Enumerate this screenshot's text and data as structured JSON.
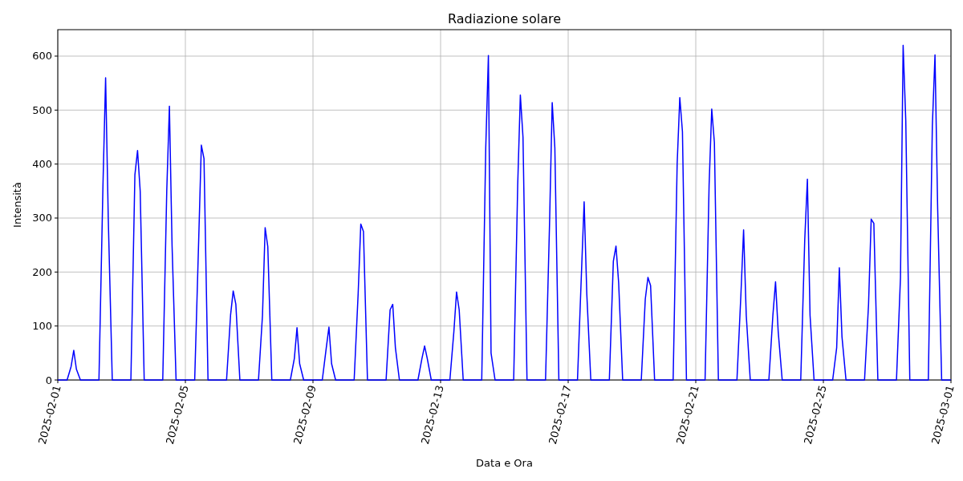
{
  "chart_data": {
    "type": "line",
    "title": "Radiazione solare",
    "xlabel": "Data e Ora",
    "ylabel": "Intensità",
    "x": [
      "2025-02-01T00:00",
      "2025-02-01T07:00",
      "2025-02-01T10:00",
      "2025-02-01T12:00",
      "2025-02-01T14:00",
      "2025-02-01T17:00",
      "2025-02-02T07:00",
      "2025-02-02T10:00",
      "2025-02-02T12:00",
      "2025-02-02T14:00",
      "2025-02-02T17:00",
      "2025-02-03T07:00",
      "2025-02-03T10:00",
      "2025-02-03T12:00",
      "2025-02-03T14:00",
      "2025-02-03T17:00",
      "2025-02-04T07:00",
      "2025-02-04T10:00",
      "2025-02-04T12:00",
      "2025-02-04T14:00",
      "2025-02-04T17:00",
      "2025-02-05T07:00",
      "2025-02-05T10:00",
      "2025-02-05T12:00",
      "2025-02-05T14:00",
      "2025-02-05T17:00",
      "2025-02-06T07:00",
      "2025-02-06T10:00",
      "2025-02-06T12:00",
      "2025-02-06T14:00",
      "2025-02-06T17:00",
      "2025-02-07T07:00",
      "2025-02-07T10:00",
      "2025-02-07T12:00",
      "2025-02-07T14:00",
      "2025-02-07T17:00",
      "2025-02-08T07:00",
      "2025-02-08T10:00",
      "2025-02-08T12:00",
      "2025-02-08T14:00",
      "2025-02-08T17:00",
      "2025-02-09T07:00",
      "2025-02-09T10:00",
      "2025-02-09T12:00",
      "2025-02-09T14:00",
      "2025-02-09T17:00",
      "2025-02-10T07:00",
      "2025-02-10T10:00",
      "2025-02-10T12:00",
      "2025-02-10T14:00",
      "2025-02-10T17:00",
      "2025-02-11T07:00",
      "2025-02-11T10:00",
      "2025-02-11T12:00",
      "2025-02-11T14:00",
      "2025-02-11T17:00",
      "2025-02-12T07:00",
      "2025-02-12T10:00",
      "2025-02-12T12:00",
      "2025-02-12T14:00",
      "2025-02-12T17:00",
      "2025-02-13T07:00",
      "2025-02-13T10:00",
      "2025-02-13T12:00",
      "2025-02-13T14:00",
      "2025-02-13T17:00",
      "2025-02-14T07:00",
      "2025-02-14T10:00",
      "2025-02-14T12:00",
      "2025-02-14T14:00",
      "2025-02-14T17:00",
      "2025-02-15T07:00",
      "2025-02-15T10:00",
      "2025-02-15T12:00",
      "2025-02-15T14:00",
      "2025-02-15T17:00",
      "2025-02-16T07:00",
      "2025-02-16T10:00",
      "2025-02-16T12:00",
      "2025-02-16T14:00",
      "2025-02-16T17:00",
      "2025-02-17T07:00",
      "2025-02-17T10:00",
      "2025-02-17T12:00",
      "2025-02-17T14:00",
      "2025-02-17T17:00",
      "2025-02-18T07:00",
      "2025-02-18T10:00",
      "2025-02-18T12:00",
      "2025-02-18T14:00",
      "2025-02-18T17:00",
      "2025-02-19T07:00",
      "2025-02-19T10:00",
      "2025-02-19T12:00",
      "2025-02-19T14:00",
      "2025-02-19T17:00",
      "2025-02-20T07:00",
      "2025-02-20T10:00",
      "2025-02-20T12:00",
      "2025-02-20T14:00",
      "2025-02-20T17:00",
      "2025-02-21T07:00",
      "2025-02-21T10:00",
      "2025-02-21T12:00",
      "2025-02-21T14:00",
      "2025-02-21T17:00",
      "2025-02-22T07:00",
      "2025-02-22T10:00",
      "2025-02-22T12:00",
      "2025-02-22T14:00",
      "2025-02-22T17:00",
      "2025-02-23T07:00",
      "2025-02-23T10:00",
      "2025-02-23T12:00",
      "2025-02-23T14:00",
      "2025-02-23T17:00",
      "2025-02-24T07:00",
      "2025-02-24T10:00",
      "2025-02-24T12:00",
      "2025-02-24T14:00",
      "2025-02-24T17:00",
      "2025-02-25T07:00",
      "2025-02-25T10:00",
      "2025-02-25T12:00",
      "2025-02-25T14:00",
      "2025-02-25T17:00",
      "2025-02-26T07:00",
      "2025-02-26T10:00",
      "2025-02-26T12:00",
      "2025-02-26T14:00",
      "2025-02-26T17:00",
      "2025-02-27T07:00",
      "2025-02-27T10:00",
      "2025-02-27T12:00",
      "2025-02-27T14:00",
      "2025-02-27T17:00",
      "2025-02-28T07:00",
      "2025-02-28T10:00",
      "2025-02-28T12:00",
      "2025-02-28T14:00",
      "2025-02-28T17:00",
      "2025-03-01T00:00"
    ],
    "series": [
      {
        "color": "#0000ff",
        "values": [
          0,
          0,
          25,
          55,
          20,
          0,
          0,
          360,
          560,
          300,
          0,
          0,
          380,
          425,
          350,
          0,
          0,
          350,
          507,
          250,
          0,
          0,
          260,
          435,
          410,
          0,
          0,
          120,
          165,
          140,
          0,
          0,
          120,
          282,
          247,
          0,
          0,
          40,
          97,
          30,
          0,
          0,
          60,
          98,
          30,
          0,
          0,
          160,
          289,
          275,
          0,
          0,
          130,
          140,
          60,
          0,
          0,
          40,
          63,
          40,
          0,
          0,
          90,
          163,
          130,
          0,
          0,
          430,
          601,
          50,
          0,
          0,
          360,
          528,
          450,
          0,
          0,
          290,
          514,
          430,
          0,
          0,
          200,
          330,
          160,
          0,
          0,
          220,
          248,
          180,
          0,
          0,
          150,
          190,
          175,
          0,
          0,
          400,
          523,
          460,
          0,
          0,
          360,
          502,
          440,
          0,
          0,
          160,
          278,
          120,
          0,
          0,
          120,
          182,
          90,
          0,
          0,
          260,
          372,
          120,
          0,
          0,
          60,
          208,
          80,
          0,
          0,
          140,
          298,
          290,
          0,
          0,
          190,
          620,
          480,
          0,
          0,
          470,
          602,
          320,
          0,
          0
        ]
      }
    ],
    "grid": true,
    "xlim": [
      "2025-02-01",
      "2025-03-01"
    ],
    "ylim": [
      0,
      649
    ],
    "xticks": [
      "2025-02-01",
      "2025-02-05",
      "2025-02-09",
      "2025-02-13",
      "2025-02-17",
      "2025-02-21",
      "2025-02-25",
      "2025-03-01"
    ],
    "yticks": [
      0,
      100,
      200,
      300,
      400,
      500,
      600
    ]
  }
}
